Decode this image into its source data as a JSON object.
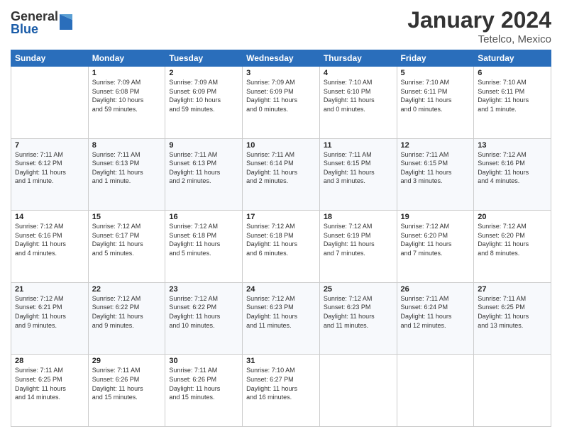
{
  "app": {
    "logo_general": "General",
    "logo_blue": "Blue",
    "month_title": "January 2024",
    "subtitle": "Tetelco, Mexico"
  },
  "calendar": {
    "headers": [
      "Sunday",
      "Monday",
      "Tuesday",
      "Wednesday",
      "Thursday",
      "Friday",
      "Saturday"
    ],
    "weeks": [
      [
        {
          "day": "",
          "info": ""
        },
        {
          "day": "1",
          "info": "Sunrise: 7:09 AM\nSunset: 6:08 PM\nDaylight: 10 hours\nand 59 minutes."
        },
        {
          "day": "2",
          "info": "Sunrise: 7:09 AM\nSunset: 6:09 PM\nDaylight: 10 hours\nand 59 minutes."
        },
        {
          "day": "3",
          "info": "Sunrise: 7:09 AM\nSunset: 6:09 PM\nDaylight: 11 hours\nand 0 minutes."
        },
        {
          "day": "4",
          "info": "Sunrise: 7:10 AM\nSunset: 6:10 PM\nDaylight: 11 hours\nand 0 minutes."
        },
        {
          "day": "5",
          "info": "Sunrise: 7:10 AM\nSunset: 6:11 PM\nDaylight: 11 hours\nand 0 minutes."
        },
        {
          "day": "6",
          "info": "Sunrise: 7:10 AM\nSunset: 6:11 PM\nDaylight: 11 hours\nand 1 minute."
        }
      ],
      [
        {
          "day": "7",
          "info": "Sunrise: 7:11 AM\nSunset: 6:12 PM\nDaylight: 11 hours\nand 1 minute."
        },
        {
          "day": "8",
          "info": "Sunrise: 7:11 AM\nSunset: 6:13 PM\nDaylight: 11 hours\nand 1 minute."
        },
        {
          "day": "9",
          "info": "Sunrise: 7:11 AM\nSunset: 6:13 PM\nDaylight: 11 hours\nand 2 minutes."
        },
        {
          "day": "10",
          "info": "Sunrise: 7:11 AM\nSunset: 6:14 PM\nDaylight: 11 hours\nand 2 minutes."
        },
        {
          "day": "11",
          "info": "Sunrise: 7:11 AM\nSunset: 6:15 PM\nDaylight: 11 hours\nand 3 minutes."
        },
        {
          "day": "12",
          "info": "Sunrise: 7:11 AM\nSunset: 6:15 PM\nDaylight: 11 hours\nand 3 minutes."
        },
        {
          "day": "13",
          "info": "Sunrise: 7:12 AM\nSunset: 6:16 PM\nDaylight: 11 hours\nand 4 minutes."
        }
      ],
      [
        {
          "day": "14",
          "info": "Sunrise: 7:12 AM\nSunset: 6:16 PM\nDaylight: 11 hours\nand 4 minutes."
        },
        {
          "day": "15",
          "info": "Sunrise: 7:12 AM\nSunset: 6:17 PM\nDaylight: 11 hours\nand 5 minutes."
        },
        {
          "day": "16",
          "info": "Sunrise: 7:12 AM\nSunset: 6:18 PM\nDaylight: 11 hours\nand 5 minutes."
        },
        {
          "day": "17",
          "info": "Sunrise: 7:12 AM\nSunset: 6:18 PM\nDaylight: 11 hours\nand 6 minutes."
        },
        {
          "day": "18",
          "info": "Sunrise: 7:12 AM\nSunset: 6:19 PM\nDaylight: 11 hours\nand 7 minutes."
        },
        {
          "day": "19",
          "info": "Sunrise: 7:12 AM\nSunset: 6:20 PM\nDaylight: 11 hours\nand 7 minutes."
        },
        {
          "day": "20",
          "info": "Sunrise: 7:12 AM\nSunset: 6:20 PM\nDaylight: 11 hours\nand 8 minutes."
        }
      ],
      [
        {
          "day": "21",
          "info": "Sunrise: 7:12 AM\nSunset: 6:21 PM\nDaylight: 11 hours\nand 9 minutes."
        },
        {
          "day": "22",
          "info": "Sunrise: 7:12 AM\nSunset: 6:22 PM\nDaylight: 11 hours\nand 9 minutes."
        },
        {
          "day": "23",
          "info": "Sunrise: 7:12 AM\nSunset: 6:22 PM\nDaylight: 11 hours\nand 10 minutes."
        },
        {
          "day": "24",
          "info": "Sunrise: 7:12 AM\nSunset: 6:23 PM\nDaylight: 11 hours\nand 11 minutes."
        },
        {
          "day": "25",
          "info": "Sunrise: 7:12 AM\nSunset: 6:23 PM\nDaylight: 11 hours\nand 11 minutes."
        },
        {
          "day": "26",
          "info": "Sunrise: 7:11 AM\nSunset: 6:24 PM\nDaylight: 11 hours\nand 12 minutes."
        },
        {
          "day": "27",
          "info": "Sunrise: 7:11 AM\nSunset: 6:25 PM\nDaylight: 11 hours\nand 13 minutes."
        }
      ],
      [
        {
          "day": "28",
          "info": "Sunrise: 7:11 AM\nSunset: 6:25 PM\nDaylight: 11 hours\nand 14 minutes."
        },
        {
          "day": "29",
          "info": "Sunrise: 7:11 AM\nSunset: 6:26 PM\nDaylight: 11 hours\nand 15 minutes."
        },
        {
          "day": "30",
          "info": "Sunrise: 7:11 AM\nSunset: 6:26 PM\nDaylight: 11 hours\nand 15 minutes."
        },
        {
          "day": "31",
          "info": "Sunrise: 7:10 AM\nSunset: 6:27 PM\nDaylight: 11 hours\nand 16 minutes."
        },
        {
          "day": "",
          "info": ""
        },
        {
          "day": "",
          "info": ""
        },
        {
          "day": "",
          "info": ""
        }
      ]
    ]
  }
}
